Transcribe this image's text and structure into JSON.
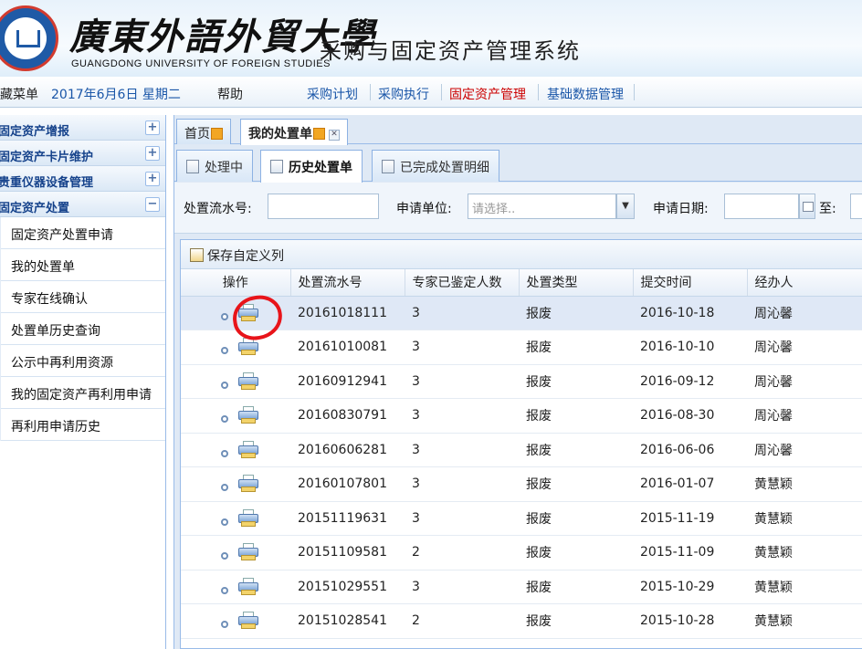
{
  "header": {
    "university_cn": "廣東外語外貿大學",
    "university_en": "GUANGDONG UNIVERSITY OF FOREIGN STUDIES",
    "system_title": "采购与固定资产管理系统"
  },
  "topbar": {
    "favorites": "藏菜单",
    "date": "2017年6月6日 星期二",
    "help": "帮助",
    "menus": [
      "采购计划",
      "采购执行",
      "固定资产管理",
      "基础数据管理"
    ],
    "active_menu": "固定资产管理"
  },
  "sidebar": {
    "groups": [
      {
        "label": "固定资产增报",
        "toggle": "+"
      },
      {
        "label": "固定资产卡片维护",
        "toggle": "+"
      },
      {
        "label": "贵重仪器设备管理",
        "toggle": "+"
      },
      {
        "label": "固定资产处置",
        "toggle": "−"
      }
    ],
    "items": [
      "固定资产处置申请",
      "我的处置单",
      "专家在线确认",
      "处置单历史查询",
      "公示中再利用资源",
      "我的固定资产再利用申请",
      "再利用申请历史"
    ]
  },
  "tabs": [
    {
      "label": "首页"
    },
    {
      "label": "我的处置单"
    }
  ],
  "subtabs": [
    "处理中",
    "历史处置单",
    "已完成处置明细"
  ],
  "filter": {
    "serial_label": "处置流水号:",
    "serial_value": "",
    "unit_label": "申请单位:",
    "unit_placeholder": "请选择..",
    "date_label": "申请日期:",
    "date_value": "",
    "to_label": "至:"
  },
  "grid": {
    "toolbar_label": "保存自定义列",
    "columns": [
      "操作",
      "处置流水号",
      "专家已鉴定人数",
      "处置类型",
      "提交时间",
      "经办人"
    ],
    "rows": [
      [
        "20161018111",
        "3",
        "报废",
        "2016-10-18",
        "周沁馨"
      ],
      [
        "20161010081",
        "3",
        "报废",
        "2016-10-10",
        "周沁馨"
      ],
      [
        "20160912941",
        "3",
        "报废",
        "2016-09-12",
        "周沁馨"
      ],
      [
        "20160830791",
        "3",
        "报废",
        "2016-08-30",
        "周沁馨"
      ],
      [
        "20160606281",
        "3",
        "报废",
        "2016-06-06",
        "周沁馨"
      ],
      [
        "20160107801",
        "3",
        "报废",
        "2016-01-07",
        "黄慧颖"
      ],
      [
        "20151119631",
        "3",
        "报废",
        "2015-11-19",
        "黄慧颖"
      ],
      [
        "20151109581",
        "2",
        "报废",
        "2015-11-09",
        "黄慧颖"
      ],
      [
        "20151029551",
        "3",
        "报废",
        "2015-10-29",
        "黄慧颖"
      ],
      [
        "20151028541",
        "2",
        "报废",
        "2015-10-28",
        "黄慧颖"
      ]
    ]
  },
  "colors": {
    "accent": "#1a56a8",
    "active_menu": "#cc0000",
    "annotation": "#e8141a"
  }
}
